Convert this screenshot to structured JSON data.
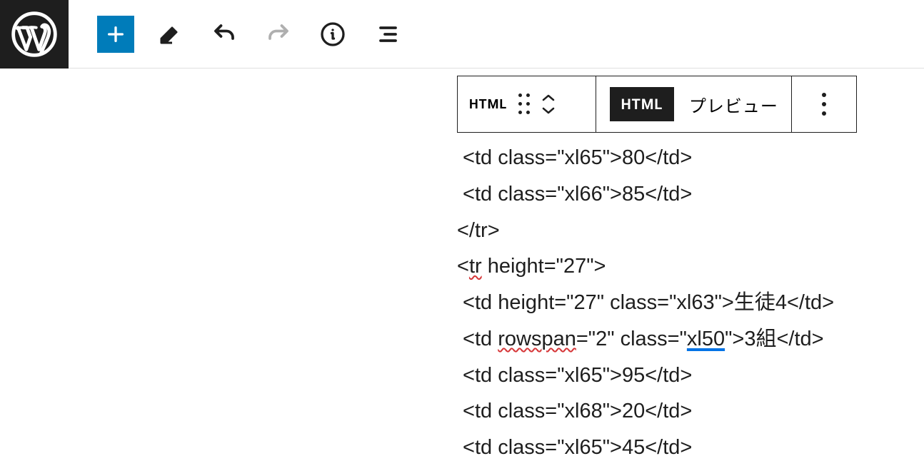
{
  "toolbar": {
    "html_type_label": "HTML",
    "html_badge_label": "HTML",
    "preview_label": "プレビュー"
  },
  "code": {
    "line1_a": " <td class=\"xl65\">80</td>",
    "line2_a": " <td class=\"xl66\">85</td>",
    "line3_a": "</tr>",
    "line4_prefix": "<",
    "line4_tr": "tr",
    "line4_suffix": " height=\"27\">",
    "line5_a": " <td height=\"27\" class=\"xl63\">生徒4</td>",
    "line6_prefix": " <td ",
    "line6_rowspan": "rowspan",
    "line6_mid": "=\"2\" class=\"",
    "line6_xl50": "xl50",
    "line6_suffix": "\">3組</td>",
    "line7_a": " <td class=\"xl65\">95</td>",
    "line8_a": " <td class=\"xl68\">20</td>",
    "line9_a": " <td class=\"xl65\">45</td>"
  }
}
